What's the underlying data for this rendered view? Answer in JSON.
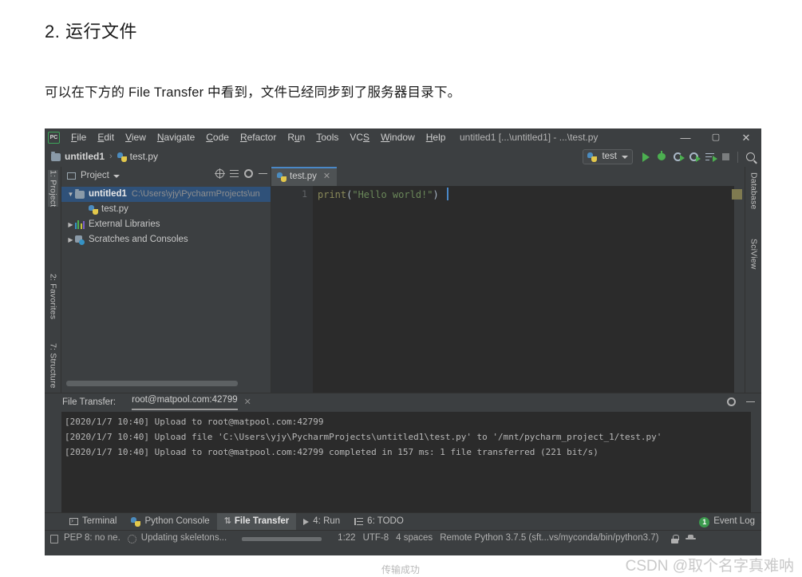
{
  "article": {
    "heading": "2. 运行文件",
    "paragraph": "可以在下方的 File Transfer 中看到，文件已经同步到了服务器目录下。"
  },
  "caption": "传输成功",
  "watermark": "CSDN @取个名字真难呐",
  "colors": {
    "accent_blue": "#4a88c7",
    "run_green": "#4caf50",
    "selection_blue": "#2f5179",
    "panel_bg": "#3c3f41",
    "editor_bg": "#2b2b2b",
    "string_green": "#6a8759"
  },
  "ide": {
    "logo": "pycharm-logo",
    "window_title": "untitled1 [...\\untitled1] - ...\\test.py",
    "menu": [
      {
        "label": "File",
        "mnemonic": "F"
      },
      {
        "label": "Edit",
        "mnemonic": "E"
      },
      {
        "label": "View",
        "mnemonic": "V"
      },
      {
        "label": "Navigate",
        "mnemonic": "N"
      },
      {
        "label": "Code",
        "mnemonic": "C"
      },
      {
        "label": "Refactor",
        "mnemonic": "R"
      },
      {
        "label": "Run",
        "mnemonic": "u"
      },
      {
        "label": "Tools",
        "mnemonic": "T"
      },
      {
        "label": "VCS",
        "mnemonic": "S"
      },
      {
        "label": "Window",
        "mnemonic": "W"
      },
      {
        "label": "Help",
        "mnemonic": "H"
      }
    ],
    "window_buttons": {
      "minimize": "—",
      "maximize": "▢",
      "close": "✕"
    },
    "breadcrumb": {
      "project": "untitled1",
      "separator": "›",
      "file": "test.py"
    },
    "run_toolbar": {
      "config_name": "test",
      "icons": [
        "run-icon",
        "debug-icon",
        "coverage-icon",
        "profile-icon",
        "run-with-console-icon",
        "stop-icon",
        "search-everywhere-icon"
      ]
    },
    "left_tool_tabs": [
      {
        "label": "1: Project",
        "selected": true
      },
      {
        "label": "2: Favorites",
        "selected": false
      },
      {
        "label": "7: Structure",
        "selected": false
      }
    ],
    "right_tool_tabs": [
      {
        "label": "Database"
      },
      {
        "label": "SciView"
      }
    ],
    "project_panel": {
      "title": "Project",
      "tools": [
        "locate-target-icon",
        "collapse-all-icon",
        "settings-gear-icon",
        "hide-icon"
      ],
      "tree": [
        {
          "label": "untitled1",
          "path": "C:\\Users\\yjy\\PycharmProjects\\un",
          "arrow": "▼",
          "icon": "folder-icon",
          "indent": 0,
          "selected": true
        },
        {
          "label": "test.py",
          "path": "",
          "arrow": "",
          "icon": "python-file-icon",
          "indent": 2,
          "selected": false
        },
        {
          "label": "External Libraries",
          "path": "",
          "arrow": "▶",
          "icon": "library-icon",
          "indent": 0,
          "selected": false
        },
        {
          "label": "Scratches and Consoles",
          "path": "",
          "arrow": "▶",
          "icon": "scratches-icon",
          "indent": 0,
          "selected": false
        }
      ]
    },
    "editor": {
      "tab_label": "test.py",
      "tab_close": "✕",
      "line_number": "1",
      "code": {
        "func": "print",
        "open_paren": "(",
        "string": "\"Hello world!\"",
        "close_paren": ")"
      }
    },
    "file_transfer": {
      "title": "File Transfer:",
      "connection": "root@matpool.com:42799",
      "close": "✕",
      "tools": [
        "settings-gear-icon",
        "hide-icon"
      ],
      "log": [
        "[2020/1/7 10:40] Upload to root@matpool.com:42799",
        "[2020/1/7 10:40] Upload file 'C:\\Users\\yjy\\PycharmProjects\\untitled1\\test.py' to '/mnt/pycharm_project_1/test.py'",
        "[2020/1/7 10:40] Upload to root@matpool.com:42799 completed in 157 ms: 1 file transferred (221 bit/s)"
      ]
    },
    "bottom_tabs": [
      {
        "label": "Terminal",
        "icon": "terminal-icon",
        "selected": false
      },
      {
        "label": "Python Console",
        "icon": "python-console-icon",
        "selected": false
      },
      {
        "label": "File Transfer",
        "icon": "transfer-arrows-icon",
        "selected": true
      },
      {
        "label": "4: Run",
        "icon": "run-play-icon",
        "selected": false
      },
      {
        "label": "6: TODO",
        "icon": "todo-list-icon",
        "selected": false
      }
    ],
    "event_log": {
      "count": "1",
      "label": "Event Log"
    },
    "status_bar": {
      "inspection": "PEP 8: no ne.",
      "background_task": "Updating skeletons...",
      "caret_position": "1:22",
      "encoding": "UTF-8",
      "indent": "4 spaces",
      "interpreter": "Remote Python 3.7.5 (sft...vs/myconda/bin/python3.7)",
      "icons": [
        "lock-icon",
        "hacker-icon"
      ]
    }
  }
}
